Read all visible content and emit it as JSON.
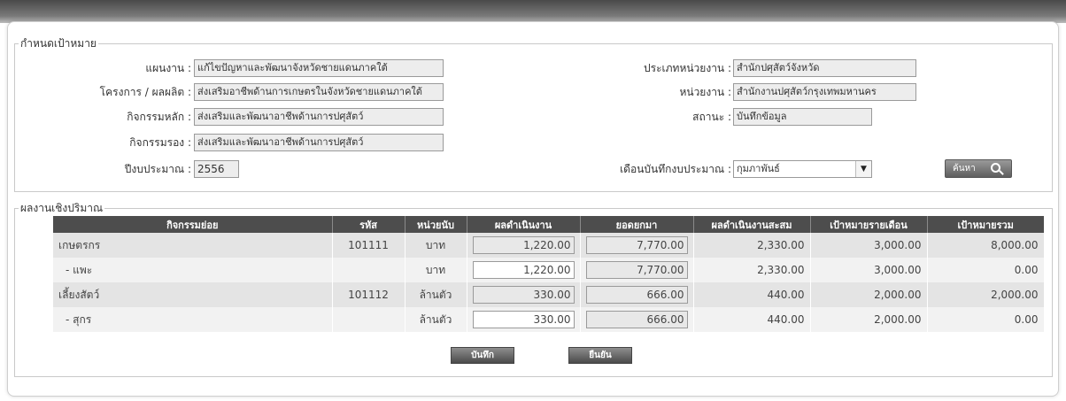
{
  "target_section": {
    "legend": "กำหนดเป้าหมาย",
    "plan_label": "แผนงาน :",
    "plan_value": "แก้ไขปัญหาและพัฒนาจังหวัดชายแดนภาคใต้",
    "project_label": "โครงการ / ผลผลิต :",
    "project_value": "ส่งเสริมอาชีพด้านการเกษตรในจังหวัดชายแดนภาคใต้",
    "main_activity_label": "กิจกรรมหลัก :",
    "main_activity_value": "ส่งเสริมและพัฒนาอาชีพด้านการปศุสัตว์",
    "sub_activity_label": "กิจกรรมรอง :",
    "sub_activity_value": "ส่งเสริมและพัฒนาอาชีพด้านการปศุสัตว์",
    "fiscal_year_label": "ปีงบประมาณ :",
    "fiscal_year_value": "2556",
    "unit_type_label": "ประเภทหน่วยงาน :",
    "unit_type_value": "สำนักปศุสัตว์จังหวัด",
    "unit_label": "หน่วยงาน :",
    "unit_value": "สำนักงานปศุสัตว์กรุงเทพมหานคร",
    "status_label": "สถานะ :",
    "status_value": "บันทึกข้อมูล",
    "month_label": "เดือนบันทึกงบประมาณ :",
    "month_value": "กุมภาพันธ์",
    "search_label": "ค้นหา"
  },
  "quantity_section": {
    "legend": "ผลงานเชิงปริมาณ",
    "columns": [
      "กิจกรรมย่อย",
      "รหัส",
      "หน่วยนับ",
      "ผลดำเนินงาน",
      "ยอดยกมา",
      "ผลดำเนินงานสะสม",
      "เป้าหมายรายเดือน",
      "เป้าหมายรวม"
    ],
    "rows": [
      {
        "name": "เกษตรกร",
        "code": "101111",
        "unit": "บาท",
        "result": "1,220.00",
        "carried": "7,770.00",
        "cumulative": "2,330.00",
        "monthly": "3,000.00",
        "total": "8,000.00"
      },
      {
        "name": "- แพะ",
        "code": "",
        "unit": "บาท",
        "result": "1,220.00",
        "carried": "7,770.00",
        "cumulative": "2,330.00",
        "monthly": "3,000.00",
        "total": "0.00"
      },
      {
        "name": "เลี้ยงสัตว์",
        "code": "101112",
        "unit": "ล้านตัว",
        "result": "330.00",
        "carried": "666.00",
        "cumulative": "440.00",
        "monthly": "2,000.00",
        "total": "2,000.00"
      },
      {
        "name": "- สุกร",
        "code": "",
        "unit": "ล้านตัว",
        "result": "330.00",
        "carried": "666.00",
        "cumulative": "440.00",
        "monthly": "2,000.00",
        "total": "0.00"
      }
    ]
  },
  "buttons": {
    "save": "บันทึก",
    "confirm": "ยืนยัน"
  }
}
